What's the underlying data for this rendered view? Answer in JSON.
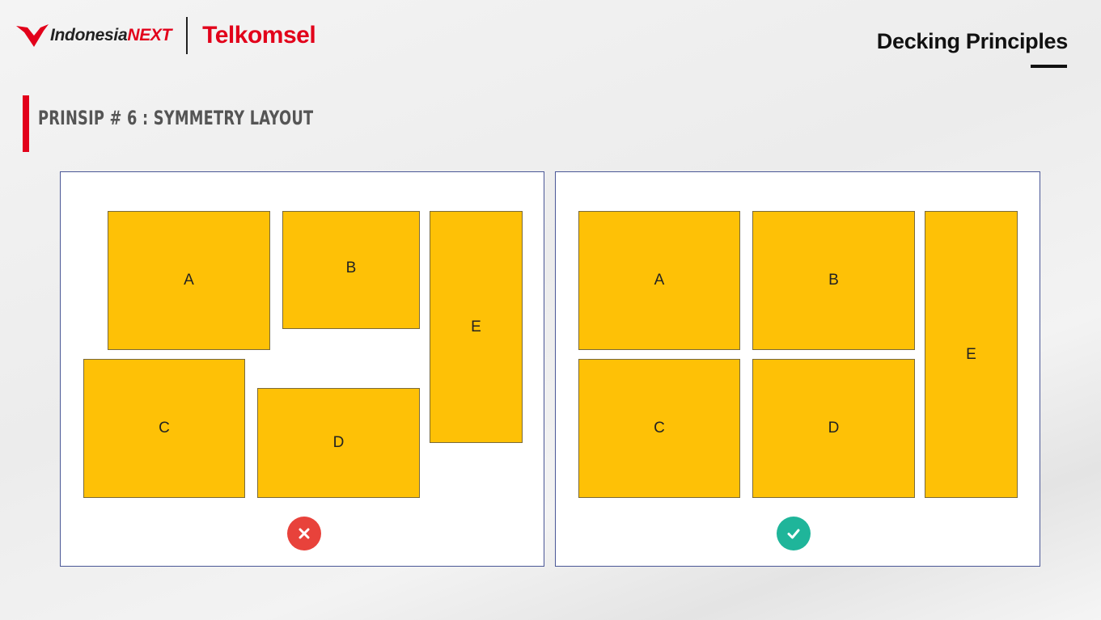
{
  "header": {
    "logo_text_1": "Indonesia",
    "logo_text_2": "NEXT",
    "brand": "Telkomsel",
    "page_title": "Decking Principles"
  },
  "section": {
    "heading": "PRINSIP # 6 : SYMMETRY LAYOUT"
  },
  "panels": {
    "bad": {
      "blocks": {
        "a": "A",
        "b": "B",
        "c": "C",
        "d": "D",
        "e": "E"
      },
      "status_icon": "x-circle-icon",
      "status_color": "#e8423b"
    },
    "good": {
      "blocks": {
        "a": "A",
        "b": "B",
        "c": "C",
        "d": "D",
        "e": "E"
      },
      "status_icon": "check-circle-icon",
      "status_color": "#1fb59a"
    }
  },
  "colors": {
    "brand_red": "#e2001a",
    "block_fill": "#fec106",
    "panel_border": "#4a5796"
  }
}
